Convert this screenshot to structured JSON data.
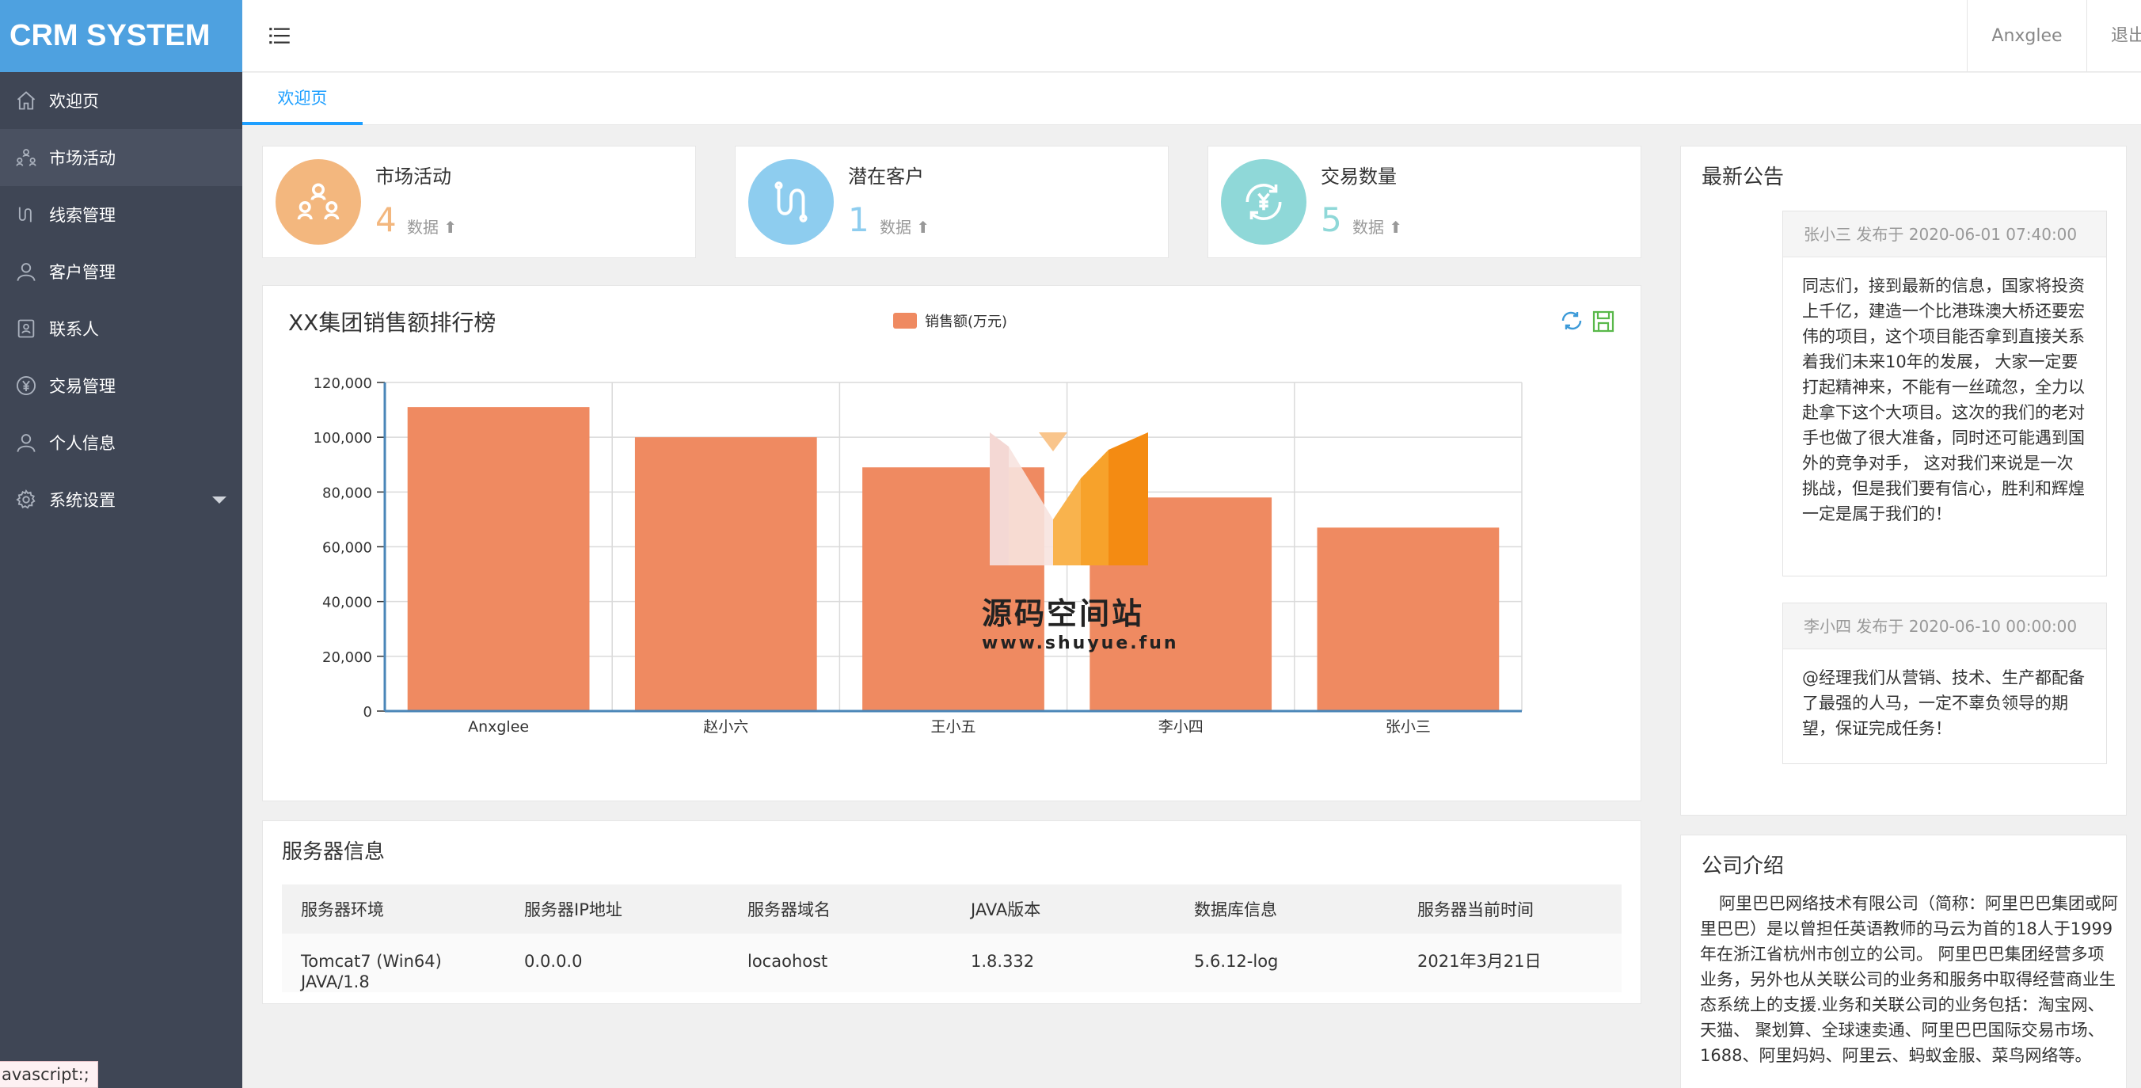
{
  "app": {
    "logo": "CRM SYSTEM"
  },
  "sidebar": {
    "items": [
      {
        "label": "欢迎页",
        "icon": "home-icon"
      },
      {
        "label": "市场活动",
        "icon": "users-network-icon"
      },
      {
        "label": "线索管理",
        "icon": "route-icon"
      },
      {
        "label": "客户管理",
        "icon": "user-icon"
      },
      {
        "label": "联系人",
        "icon": "contact-card-icon"
      },
      {
        "label": "交易管理",
        "icon": "yuan-icon"
      },
      {
        "label": "个人信息",
        "icon": "user-icon"
      },
      {
        "label": "系统设置",
        "icon": "gear-icon"
      }
    ]
  },
  "header": {
    "user": "Anxglee",
    "logout": "退出"
  },
  "tabs": [
    {
      "label": "欢迎页"
    }
  ],
  "stats": [
    {
      "title": "市场活动",
      "value": "4",
      "label": "数据",
      "color": "#f3b77e",
      "value_color": "#f3b77e",
      "icon": "users-network-icon"
    },
    {
      "title": "潜在客户",
      "value": "1",
      "label": "数据",
      "color": "#8ecdef",
      "value_color": "#8ecdef",
      "icon": "route-icon"
    },
    {
      "title": "交易数量",
      "value": "5",
      "label": "数据",
      "color": "#8fd8d8",
      "value_color": "#8fd8d8",
      "icon": "yuan-refresh-icon"
    }
  ],
  "chart_data": {
    "type": "bar",
    "title": "XX集团销售额排行榜",
    "legend": "销售额(万元)",
    "legend_position": "top-center",
    "categories": [
      "Anxglee",
      "赵小六",
      "王小五",
      "李小四",
      "张小三"
    ],
    "series": [
      {
        "name": "销售额(万元)",
        "values": [
          111000,
          100000,
          89000,
          78000,
          67000
        ]
      }
    ],
    "ylim": [
      0,
      120000
    ],
    "yticks": [
      "0",
      "20,000",
      "40,000",
      "60,000",
      "80,000",
      "100,000",
      "120,000"
    ],
    "grid": true,
    "bar_color": "#ef8a61"
  },
  "watermark": {
    "text": "源码空间站",
    "url": "www.shuyue.fun"
  },
  "server": {
    "title": "服务器信息",
    "headers": [
      "服务器环境",
      "服务器IP地址",
      "服务器域名",
      "JAVA版本",
      "数据库信息",
      "服务器当前时间"
    ],
    "row": [
      "Tomcat7 (Win64)",
      "JAVA/1.8",
      "0.0.0.0",
      "locaohost",
      "1.8.332",
      "5.6.12-log",
      "2021年3月21日"
    ]
  },
  "notices": {
    "title": "最新公告",
    "items": [
      {
        "head": "张小三 发布于 2020-06-01 07:40:00",
        "body": "同志们，接到最新的信息，国家将投资上千亿，建造一个比港珠澳大桥还要宏伟的项目，这个项目能否拿到直接关系着我们未来10年的发展， 大家一定要打起精神来，不能有一丝疏忽，全力以赴拿下这个大项目。这次的我们的老对手也做了很大准备，同时还可能遇到国外的竞争对手， 这对我们来说是一次挑战，但是我们要有信心，胜利和辉煌一定是属于我们的！"
      },
      {
        "head": "李小四 发布于 2020-06-10 00:00:00",
        "body": "@经理我们从营销、技术、生产都配备了最强的人马，一定不辜负领导的期望，保证完成任务！"
      }
    ]
  },
  "company": {
    "title": "公司介绍",
    "text": "阿里巴巴网络技术有限公司（简称：阿里巴巴集团或阿里巴巴）是以曾担任英语教师的马云为首的18人于1999年在浙江省杭州市创立的公司。 阿里巴巴集团经营多项业务，另外也从关联公司的业务和服务中取得经营商业生态系统上的支援.业务和关联公司的业务包括：淘宝网、天猫、 聚划算、全球速卖通、阿里巴巴国际交易市场、1688、阿里妈妈、阿里云、蚂蚁金服、菜鸟网络等。"
  },
  "status_bar": {
    "text": "avascript:;"
  }
}
